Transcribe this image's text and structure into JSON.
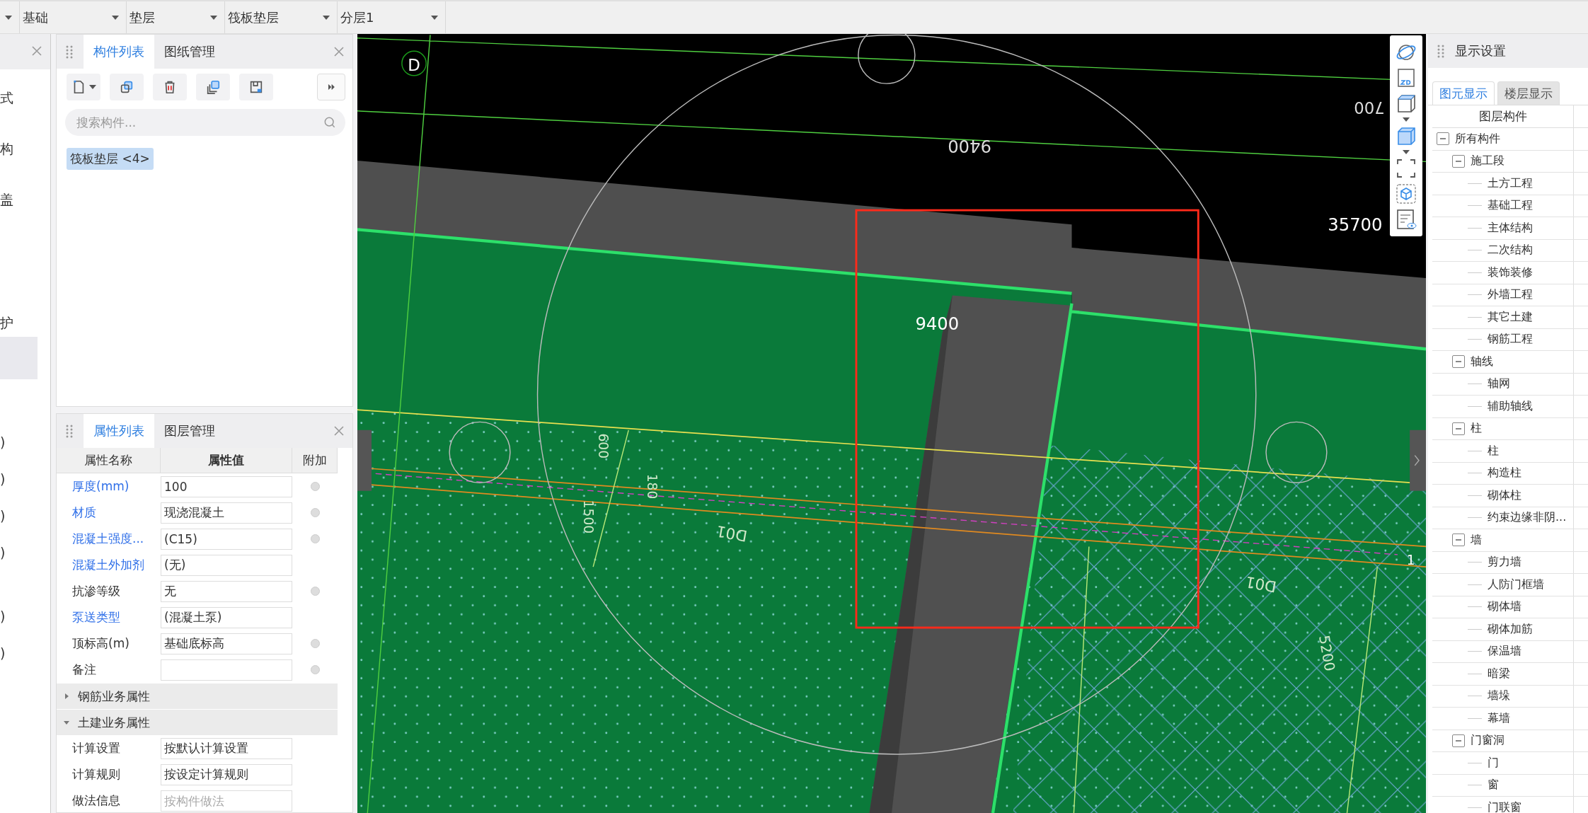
{
  "toolbar": {
    "dropdowns": [
      {
        "value": "基础"
      },
      {
        "value": "垫层"
      },
      {
        "value": "筏板垫层"
      },
      {
        "value": "分层1"
      }
    ]
  },
  "side_panel": {
    "items": [
      {
        "text": "式"
      },
      {
        "text": "构"
      },
      {
        "text": "盖"
      },
      {
        "text": "护"
      },
      {
        "text": ")"
      },
      {
        "text": ")"
      },
      {
        "text": ")"
      },
      {
        "text": ")"
      },
      {
        "text": ")"
      },
      {
        "text": ")"
      }
    ]
  },
  "component_panel": {
    "tabs": [
      {
        "label": "构件列表",
        "selected": true
      },
      {
        "label": "图纸管理",
        "selected": false
      }
    ],
    "search": {
      "placeholder": "搜索构件..."
    },
    "items": [
      {
        "label": "筏板垫层 <4>",
        "selected": true
      }
    ]
  },
  "property_panel": {
    "tabs": [
      {
        "label": "属性列表",
        "selected": true
      },
      {
        "label": "图层管理",
        "selected": false
      }
    ],
    "columns": [
      "属性名称",
      "属性值",
      "附加"
    ],
    "rows": [
      {
        "kind": "field",
        "name": "厚度(mm)",
        "value": "100",
        "linked": true,
        "extra": true
      },
      {
        "kind": "field",
        "name": "材质",
        "value": "现浇混凝土",
        "linked": true,
        "extra": true
      },
      {
        "kind": "field",
        "name": "混凝土强度...",
        "value": "(C15)",
        "linked": true,
        "extra": true
      },
      {
        "kind": "field",
        "name": "混凝土外加剂",
        "value": "(无)",
        "linked": true,
        "extra": false
      },
      {
        "kind": "field",
        "name": "抗渗等级",
        "value": "无",
        "linked": false,
        "extra": true
      },
      {
        "kind": "field",
        "name": "泵送类型",
        "value": "(混凝土泵)",
        "linked": true,
        "extra": false
      },
      {
        "kind": "field",
        "name": "顶标高(m)",
        "value": "基础底标高",
        "linked": false,
        "extra": true
      },
      {
        "kind": "field",
        "name": "备注",
        "linked": false,
        "extra": true
      },
      {
        "kind": "group",
        "name": "钢筋业务属性",
        "expanded": false
      },
      {
        "kind": "group",
        "name": "土建业务属性",
        "expanded": true
      },
      {
        "kind": "field",
        "name": "计算设置",
        "value": "按默认计算设置",
        "linked": false,
        "extra": false
      },
      {
        "kind": "field",
        "name": "计算规则",
        "value": "按设定计算规则",
        "linked": false,
        "extra": false
      },
      {
        "kind": "field",
        "name": "做法信息",
        "placeholder": "按构件做法",
        "linked": false,
        "extra": false
      }
    ]
  },
  "canvas": {
    "labels": [
      {
        "text": "D"
      },
      {
        "text": "9400"
      },
      {
        "text": "700"
      },
      {
        "text": "35700"
      },
      {
        "text": "9400"
      },
      {
        "text": "600"
      },
      {
        "text": "180"
      },
      {
        "text": "1500"
      },
      {
        "text": "D01"
      },
      {
        "text": "D01"
      },
      {
        "text": "5200"
      },
      {
        "text": "1"
      }
    ]
  },
  "display_panel": {
    "title": "显示设置",
    "tabs": [
      {
        "label": "图元显示",
        "selected": true
      },
      {
        "label": "楼层显示",
        "selected": false
      }
    ],
    "column": "图层构件",
    "tree": [
      {
        "label": "所有构件",
        "expanded": true,
        "children": [
          {
            "label": "施工段",
            "expanded": true,
            "children": [
              {
                "label": "土方工程"
              },
              {
                "label": "基础工程"
              },
              {
                "label": "主体结构"
              },
              {
                "label": "二次结构"
              },
              {
                "label": "装饰装修"
              },
              {
                "label": "外墙工程"
              },
              {
                "label": "其它土建"
              },
              {
                "label": "钢筋工程"
              }
            ]
          },
          {
            "label": "轴线",
            "expanded": true,
            "children": [
              {
                "label": "轴网"
              },
              {
                "label": "辅助轴线"
              }
            ]
          },
          {
            "label": "柱",
            "expanded": true,
            "children": [
              {
                "label": "柱"
              },
              {
                "label": "构造柱"
              },
              {
                "label": "砌体柱"
              },
              {
                "label": "约束边缘非阴..."
              }
            ]
          },
          {
            "label": "墙",
            "expanded": true,
            "children": [
              {
                "label": "剪力墙"
              },
              {
                "label": "人防门框墙"
              },
              {
                "label": "砌体墙"
              },
              {
                "label": "砌体加筋"
              },
              {
                "label": "保温墙"
              },
              {
                "label": "暗梁"
              },
              {
                "label": "墙垛"
              },
              {
                "label": "幕墙"
              }
            ]
          },
          {
            "label": "门窗洞",
            "expanded": true,
            "children": [
              {
                "label": "门"
              },
              {
                "label": "窗"
              },
              {
                "label": "门联窗"
              }
            ]
          }
        ]
      }
    ]
  }
}
